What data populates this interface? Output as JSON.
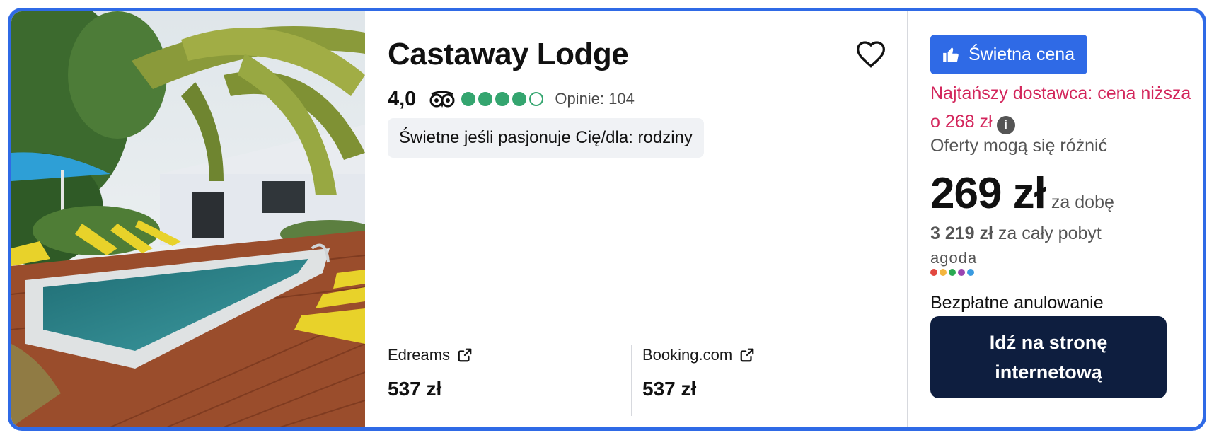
{
  "hotel": {
    "name": "Castaway Lodge",
    "rating": "4,0",
    "bubbles_filled": 4,
    "bubbles_total": 5,
    "reviews_label": "Opinie: 104",
    "tag": "Świetne jeśli pasjonuje Cię/dla: rodziny"
  },
  "providers": [
    {
      "name": "Edreams",
      "price": "537 zł"
    },
    {
      "name": "Booking.com",
      "price": "537 zł"
    }
  ],
  "deal": {
    "badge": "Świetna cena",
    "cheapest_note": "Najtańszy dostawca: cena niższa o 268 zł",
    "offers_note": "Oferty mogą się różnić",
    "price": "269 zł",
    "price_unit": "za dobę",
    "total_amount": "3 219 zł",
    "total_suffix": "za cały pobyt",
    "provider_logo_text": "agoda",
    "free_cancel": "Bezpłatne anulowanie",
    "cta": "Idź na stronę internetową"
  },
  "icons": {
    "favorite": "heart-icon",
    "tripadvisor": "tripadvisor-owl-icon",
    "external": "external-link-icon",
    "thumb": "thumbs-up-icon",
    "info": "info-icon"
  },
  "colors": {
    "accent": "#2f6ae6",
    "bubble": "#34a56f",
    "highlight": "#d3265c",
    "cta_bg": "#0e1e3f",
    "agoda_dots": [
      "#e2473f",
      "#f4b63f",
      "#2aa952",
      "#9a44b1",
      "#3a9be0"
    ]
  }
}
